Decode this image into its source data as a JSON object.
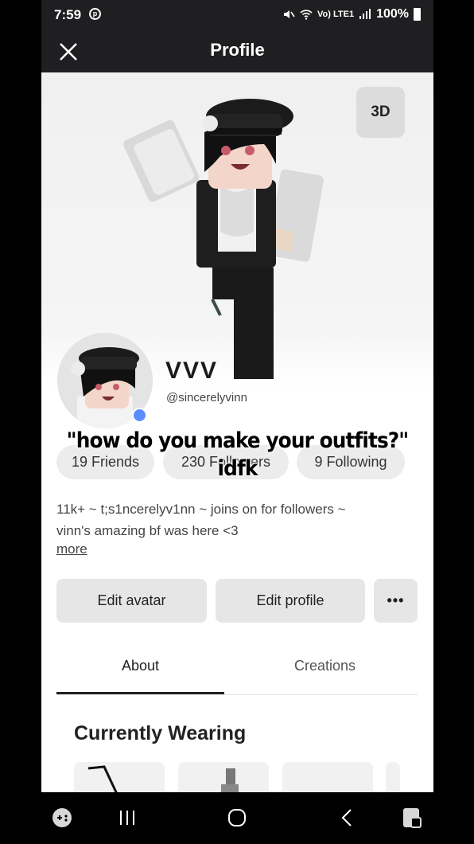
{
  "status_bar": {
    "time": "7:59",
    "app_icon": "p",
    "network": "Vo) LTE1",
    "battery": "100%"
  },
  "header": {
    "title": "Profile",
    "close_icon": "close-icon"
  },
  "avatar_view": {
    "toggle_label": "3D"
  },
  "profile": {
    "display_name": "VVV",
    "username": "@sincerelyvinn",
    "online_color": "#5b8cff"
  },
  "stats": {
    "friends": "19 Friends",
    "followers": "230 Followers",
    "following": "9 Following"
  },
  "overlay_caption": {
    "line1": "\"how do you make your outfits?\"",
    "line2": "idfk"
  },
  "bio": {
    "line1": "11k+ ~ t;s1ncerelyv1nn ~ joins on for followers ~",
    "line2": "vinn's amazing bf was here <3",
    "more_label": "more"
  },
  "actions": {
    "edit_avatar": "Edit avatar",
    "edit_profile": "Edit profile",
    "more": "•••"
  },
  "tabs": [
    {
      "label": "About",
      "active": true
    },
    {
      "label": "Creations",
      "active": false
    }
  ],
  "currently_wearing": {
    "title": "Currently Wearing"
  },
  "nav_bar": {
    "icons": [
      "game-launcher-icon",
      "recent-apps-icon",
      "home-icon",
      "back-icon",
      "screenshot-assistant-icon"
    ]
  }
}
